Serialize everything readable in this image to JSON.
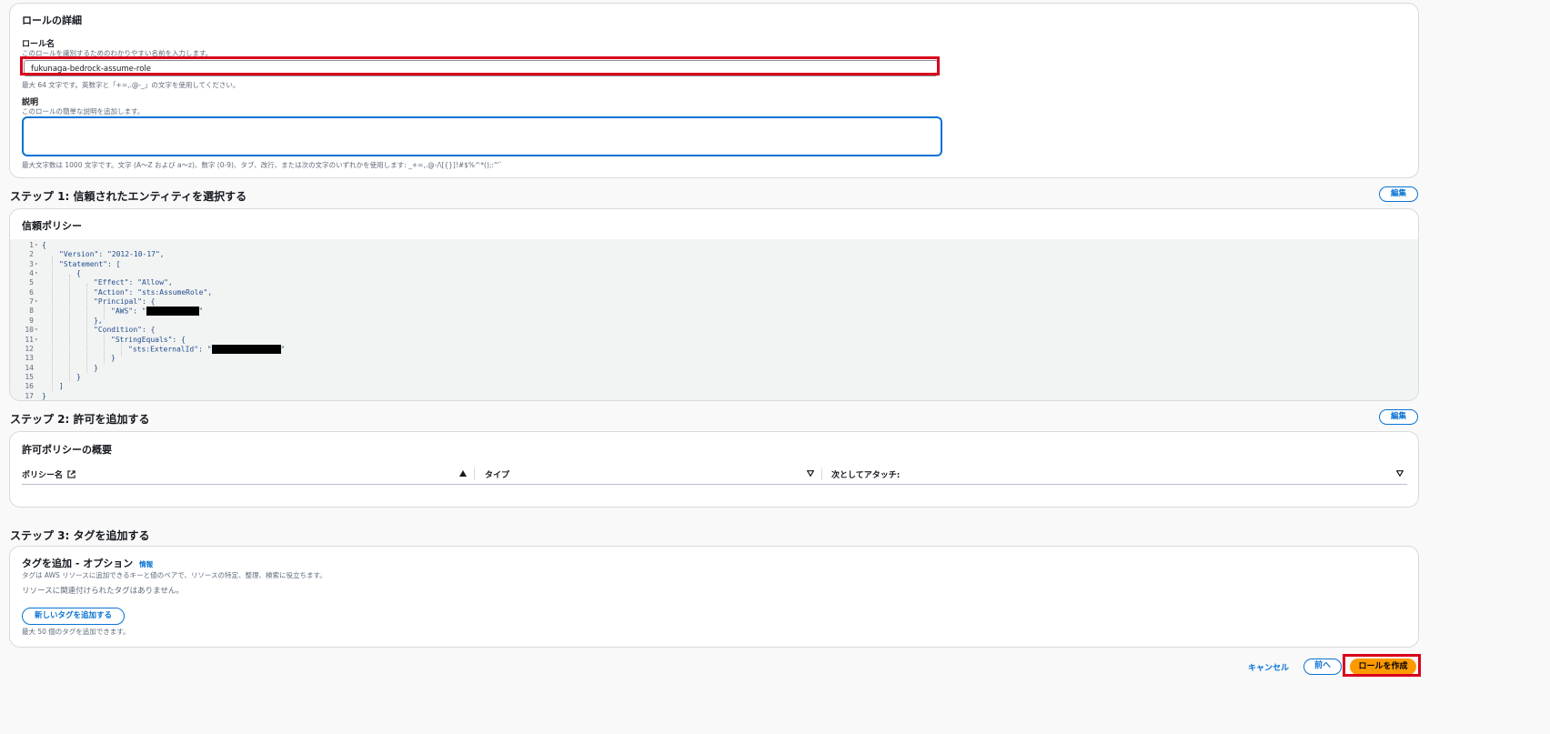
{
  "role_details": {
    "title": "ロールの詳細",
    "name_label": "ロール名",
    "name_desc": "このロールを識別するためのわかりやすい名前を入力します。",
    "name_value": "fukunaga-bedrock-assume-role",
    "name_hint": "最大 64 文字です。英数字と「+=,.@-_」の文字を使用してください。",
    "desc_label": "説明",
    "desc_desc": "このロールの簡単な説明を追加します。",
    "desc_value": "",
    "desc_hint": "最大文字数は 1000 文字です。文字 (A〜Z および a〜z)、数字 (0-9)、タブ、改行、または次の文字のいずれかを使用します: _+=,.@-/\\[{}]!#$%^*();:\"'`"
  },
  "step1": {
    "title": "ステップ 1: 信頼されたエンティティを選択する",
    "edit_label": "編集",
    "card_title": "信頼ポリシー",
    "code_lines": [
      {
        "n": "1",
        "text": "{"
      },
      {
        "n": "2",
        "text": "\"Version\": \"2012-10-17\","
      },
      {
        "n": "3",
        "text": "\"Statement\": ["
      },
      {
        "n": "4",
        "text": "{"
      },
      {
        "n": "5",
        "text": "\"Effect\": \"Allow\","
      },
      {
        "n": "6",
        "text": "\"Action\": \"sts:AssumeRole\","
      },
      {
        "n": "7",
        "text": "\"Principal\": {"
      },
      {
        "n": "8",
        "text": "\"AWS\": \""
      },
      {
        "n": "9",
        "text": "},"
      },
      {
        "n": "10",
        "text": "\"Condition\": {"
      },
      {
        "n": "11",
        "text": "\"StringEquals\": {"
      },
      {
        "n": "12",
        "text": "\"sts:ExternalId\": \""
      },
      {
        "n": "13",
        "text": "}"
      },
      {
        "n": "14",
        "text": "}"
      },
      {
        "n": "15",
        "text": "}"
      },
      {
        "n": "16",
        "text": "]"
      },
      {
        "n": "17",
        "text": "}"
      }
    ]
  },
  "step2": {
    "title": "ステップ 2: 許可を追加する",
    "edit_label": "編集",
    "card_title": "許可ポリシーの概要",
    "columns": [
      "ポリシー名",
      "タイプ",
      "次としてアタッチ:"
    ]
  },
  "step3": {
    "title": "ステップ 3: タグを追加する",
    "card_title": "タグを追加 - オプション",
    "info_label": "情報",
    "card_desc": "タグは AWS リソースに追加できるキーと値のペアで、リソースの特定、整理、検索に役立ちます。",
    "empty_text": "リソースに関連付けられたタグはありません。",
    "add_tag_label": "新しいタグを追加する",
    "limit_text": "最大 50 個のタグを追加できます。"
  },
  "footer": {
    "cancel_label": "キャンセル",
    "prev_label": "前へ",
    "create_label": "ロールを作成"
  },
  "colors": {
    "accent": "#0972d3",
    "highlight": "#d9001b",
    "primary_button": "#ff9900"
  }
}
